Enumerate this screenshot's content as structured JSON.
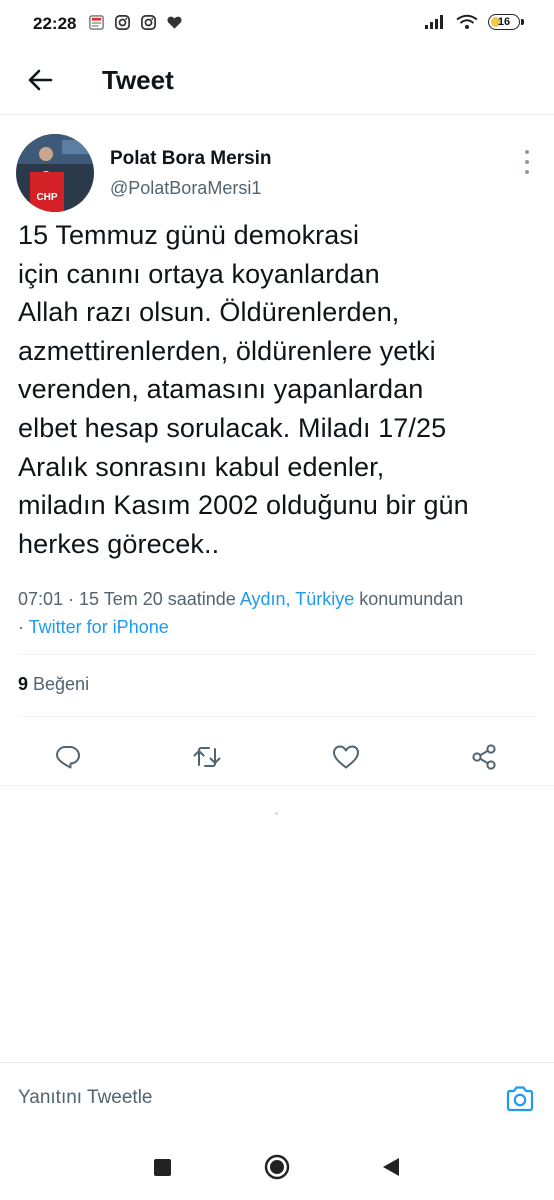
{
  "status_bar": {
    "time": "22:28",
    "battery": "16",
    "left_icons": [
      "news-app-icon",
      "instagram-icon",
      "instagram-icon",
      "heart-icon"
    ],
    "right_icons": [
      "signal-icon",
      "wifi-icon",
      "battery-icon"
    ]
  },
  "header": {
    "title": "Tweet",
    "back_icon": "arrow-left-icon"
  },
  "tweet": {
    "author_name": "Polat Bora Mersin",
    "author_handle": "@PolatBoraMersi1",
    "avatar_badge": "CHP",
    "text_lines": [
      "15 Temmuz günü demokrasi",
      "için canını ortaya koyanlardan",
      "Allah razı olsun. Öldürenlerden,",
      "azmettirenlerden, öldürenlere yetki",
      "verenden, atamasını yapanlardan",
      "elbet hesap sorulacak. Miladı 17/25",
      "Aralık sonrasını kabul edenler,",
      "miladın Kasım 2002 olduğunu bir gün",
      "herkes görecek.."
    ],
    "meta_time": "07:01 · 15 Tem 20 saatinde ",
    "meta_location": "Aydın, Türkiye",
    "meta_suffix": " konumundan",
    "meta_sep": "· ",
    "meta_source": "Twitter for iPhone",
    "likes_count": "9",
    "likes_label": " Beğeni"
  },
  "actions": [
    "reply-icon",
    "retweet-icon",
    "like-icon",
    "share-icon"
  ],
  "reply_bar": {
    "placeholder": "Yanıtını Tweetle",
    "camera_icon": "camera-icon"
  },
  "nav_bar": [
    "recents-square-icon",
    "home-circle-icon",
    "back-triangle-icon"
  ],
  "colors": {
    "accent": "#1d9bf0",
    "text_primary": "#0f1419",
    "text_secondary": "#536471",
    "divider": "#eff3f4"
  }
}
